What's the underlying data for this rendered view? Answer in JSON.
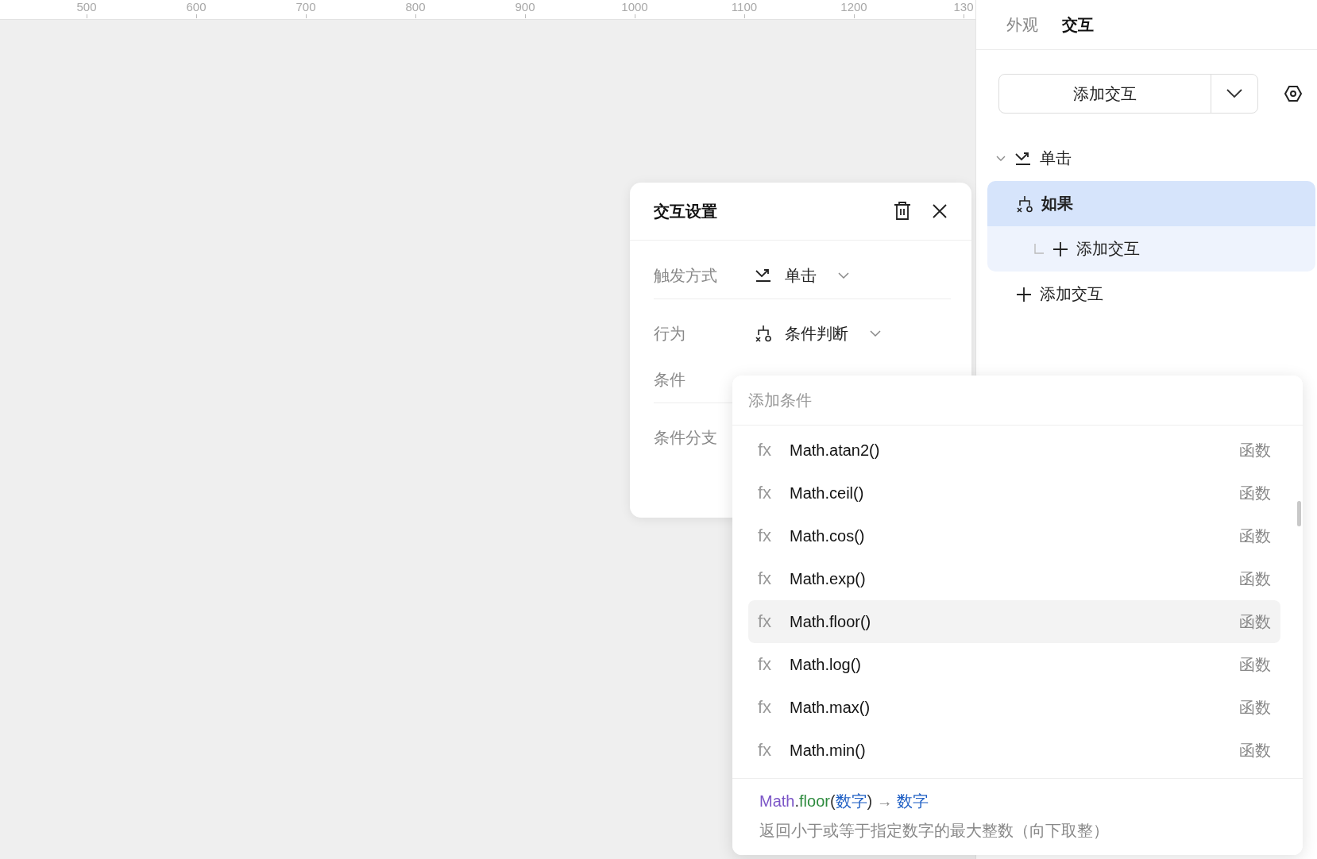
{
  "ruler": {
    "ticks": [
      "500",
      "600",
      "700",
      "800",
      "900",
      "1000",
      "1100",
      "1200",
      "130"
    ]
  },
  "panel": {
    "tabs": [
      {
        "label": "外观",
        "selected": false
      },
      {
        "label": "交互",
        "selected": true
      }
    ],
    "add_button": "添加交互",
    "tree": [
      {
        "label": "单击",
        "kind": "trigger",
        "expanded": true,
        "selected": false,
        "children": [
          {
            "label": "如果",
            "kind": "condition",
            "selected": true,
            "children": [
              {
                "label": "添加交互",
                "kind": "add",
                "selected": false
              }
            ]
          },
          {
            "label": "添加交互",
            "kind": "add",
            "selected": false
          }
        ]
      }
    ]
  },
  "dialog": {
    "title": "交互设置",
    "rows": [
      {
        "label": "触发方式",
        "kind": "trigger",
        "value": "单击",
        "divider": true
      },
      {
        "label": "行为",
        "kind": "action",
        "value": "条件判断",
        "divider": false
      },
      {
        "label": "条件",
        "kind": "label",
        "divider": true
      },
      {
        "label": "条件分支",
        "kind": "label",
        "divider": false
      }
    ]
  },
  "dropdown": {
    "placeholder": "添加条件",
    "items": [
      {
        "icon": "fx",
        "name": "Math.atan2()",
        "type": "函数",
        "selected": false
      },
      {
        "icon": "fx",
        "name": "Math.ceil()",
        "type": "函数",
        "selected": false
      },
      {
        "icon": "fx",
        "name": "Math.cos()",
        "type": "函数",
        "selected": false
      },
      {
        "icon": "fx",
        "name": "Math.exp()",
        "type": "函数",
        "selected": false
      },
      {
        "icon": "fx",
        "name": "Math.floor()",
        "type": "函数",
        "selected": true
      },
      {
        "icon": "fx",
        "name": "Math.log()",
        "type": "函数",
        "selected": false
      },
      {
        "icon": "fx",
        "name": "Math.max()",
        "type": "函数",
        "selected": false
      },
      {
        "icon": "fx",
        "name": "Math.min()",
        "type": "函数",
        "selected": false
      }
    ],
    "detail": {
      "signature": [
        {
          "kind": "object",
          "text": "Math"
        },
        {
          "kind": "punct",
          "text": "."
        },
        {
          "kind": "method",
          "text": "floor"
        },
        {
          "kind": "punct",
          "text": "("
        },
        {
          "kind": "param",
          "text": "数字"
        },
        {
          "kind": "punct",
          "text": ")"
        },
        {
          "kind": "arrow",
          "text": " → "
        },
        {
          "kind": "param",
          "text": "数字"
        }
      ],
      "description": "返回小于或等于指定数字的最大整数（向下取整）"
    }
  }
}
